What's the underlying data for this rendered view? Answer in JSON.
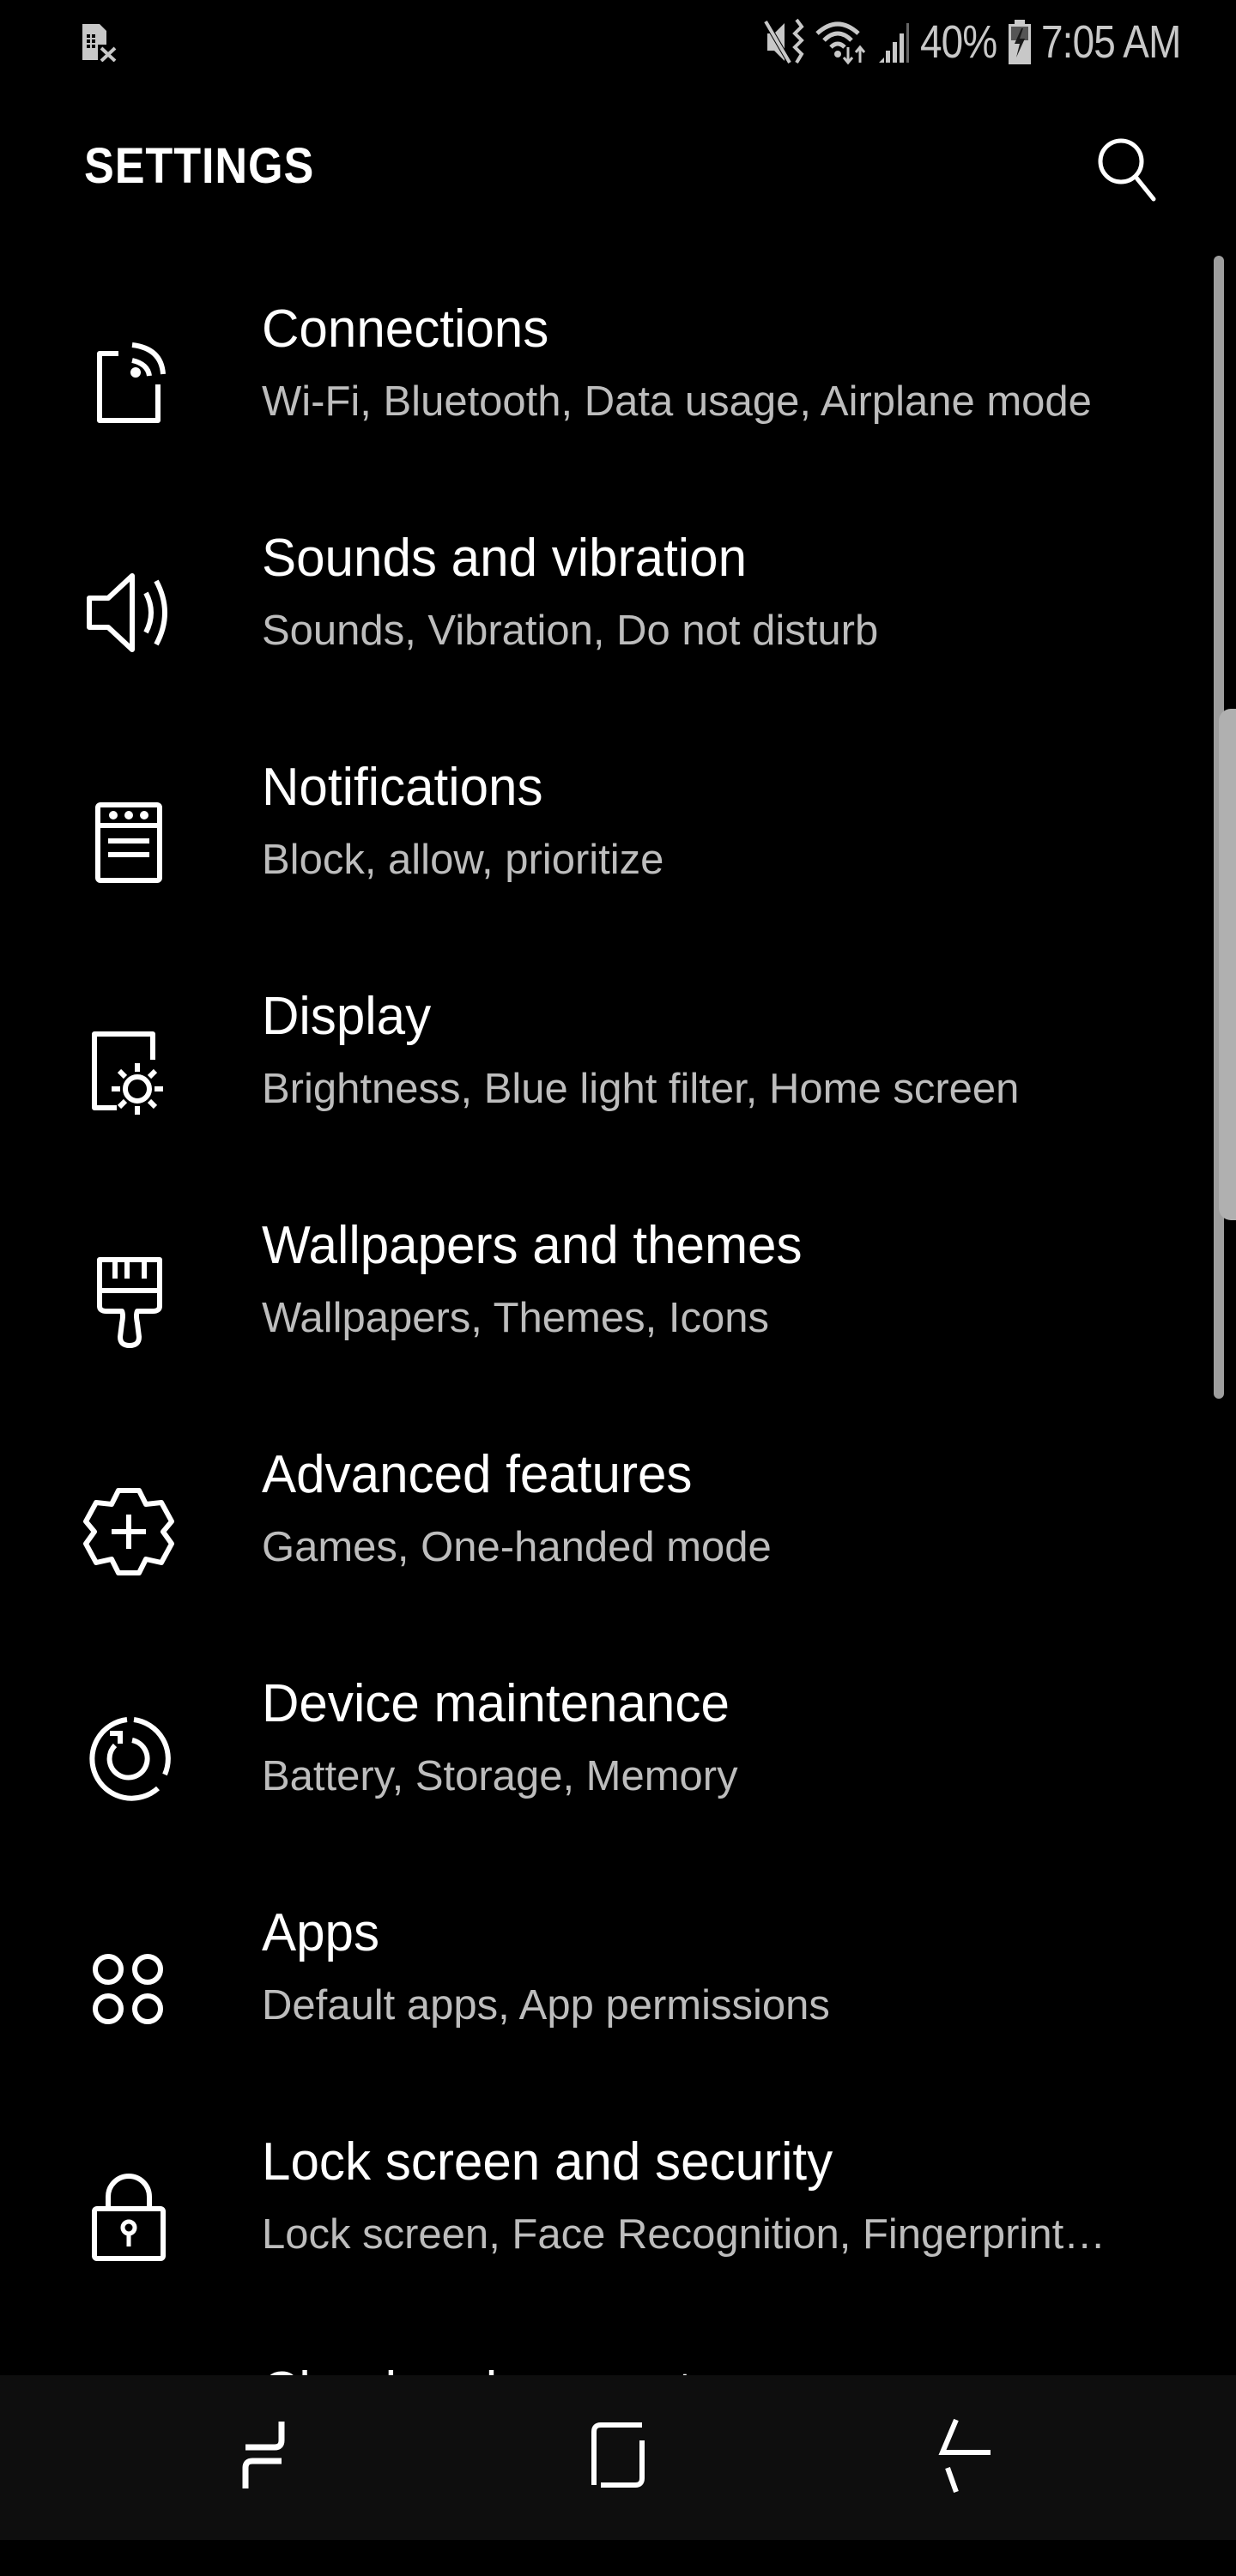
{
  "status_bar": {
    "left_icon": "no-sim-icon",
    "icons": [
      "mute-vibrate-icon",
      "wifi-data-icon",
      "signal-icon"
    ],
    "battery_percent": "40%",
    "battery_icon": "battery-charging-icon",
    "time": "7:05 AM"
  },
  "header": {
    "title": "SETTINGS",
    "search_icon": "search-icon"
  },
  "settings": [
    {
      "icon": "connections-icon",
      "title": "Connections",
      "subtitle": "Wi-Fi, Bluetooth, Data usage, Airplane mode"
    },
    {
      "icon": "speaker-icon",
      "title": "Sounds and vibration",
      "subtitle": "Sounds, Vibration, Do not disturb"
    },
    {
      "icon": "notifications-icon",
      "title": "Notifications",
      "subtitle": "Block, allow, prioritize"
    },
    {
      "icon": "display-icon",
      "title": "Display",
      "subtitle": "Brightness, Blue light filter, Home screen"
    },
    {
      "icon": "paintbrush-icon",
      "title": "Wallpapers and themes",
      "subtitle": "Wallpapers, Themes, Icons"
    },
    {
      "icon": "gear-plus-icon",
      "title": "Advanced features",
      "subtitle": "Games, One-handed mode"
    },
    {
      "icon": "device-maintenance-icon",
      "title": "Device maintenance",
      "subtitle": "Battery, Storage, Memory"
    },
    {
      "icon": "apps-icon",
      "title": "Apps",
      "subtitle": "Default apps, App permissions"
    },
    {
      "icon": "lock-icon",
      "title": "Lock screen and security",
      "subtitle": "Lock screen, Face Recognition, Fingerprint…"
    },
    {
      "icon": "cloud-icon",
      "title": "Cloud and accounts",
      "subtitle": ""
    }
  ],
  "nav_bar": {
    "recents": "recents-icon",
    "home": "home-icon",
    "back": "back-icon"
  },
  "colors": {
    "background": "#000000",
    "title_text": "#ffffff",
    "subtitle_text": "#bdbdbd",
    "status_text": "#c8c8c8",
    "nav_background": "#0e0e0e"
  }
}
